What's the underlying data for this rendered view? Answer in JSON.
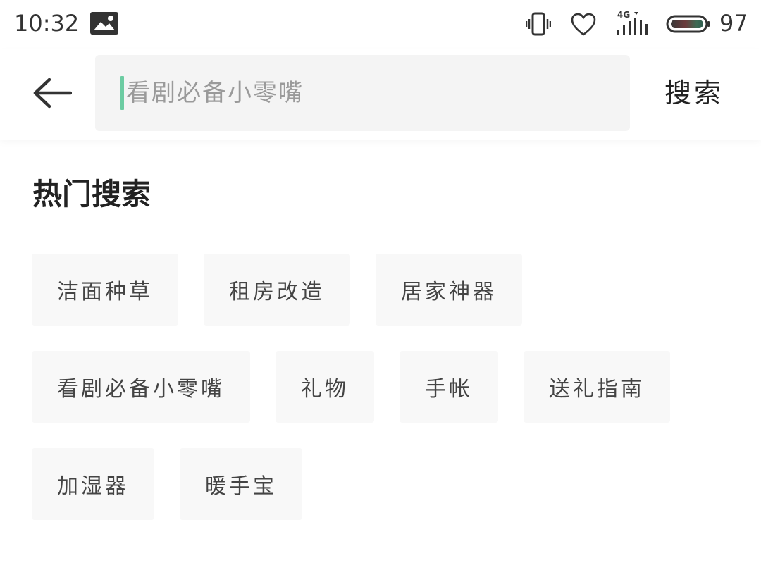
{
  "status_bar": {
    "time": "10:32",
    "network": "4G",
    "battery": "97",
    "icons": [
      "gallery-icon",
      "vibrate-icon",
      "heart-icon",
      "signal-icon",
      "battery-icon"
    ]
  },
  "header": {
    "back_icon": "arrow-left-icon",
    "search_placeholder": "看剧必备小零嘴",
    "search_button_label": "搜索",
    "cursor_color": "#6ccca2"
  },
  "hot_search": {
    "title": "热门搜索",
    "tags": [
      "洁面种草",
      "租房改造",
      "居家神器",
      "看剧必备小零嘴",
      "礼物",
      "手帐",
      "送礼指南",
      "加湿器",
      "暖手宝"
    ]
  }
}
